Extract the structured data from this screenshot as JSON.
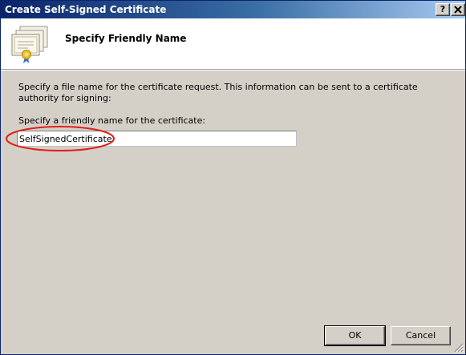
{
  "window": {
    "title": "Create Self-Signed Certificate",
    "help_label": "?",
    "close_label": "X"
  },
  "header": {
    "title": "Specify Friendly Name"
  },
  "body": {
    "description": "Specify a file name for the certificate request.  This information can be sent to a certificate authority for signing:",
    "prompt": "Specify a friendly name for the certificate:",
    "friendly_name_value": "SelfSignedCertificate",
    "annotation_color": "#e0201c"
  },
  "buttons": {
    "ok_label": "OK",
    "cancel_label": "Cancel"
  },
  "icons": {
    "header": "certificate-icon",
    "help": "help-icon",
    "close": "close-icon",
    "grip": "resize-grip-icon"
  }
}
